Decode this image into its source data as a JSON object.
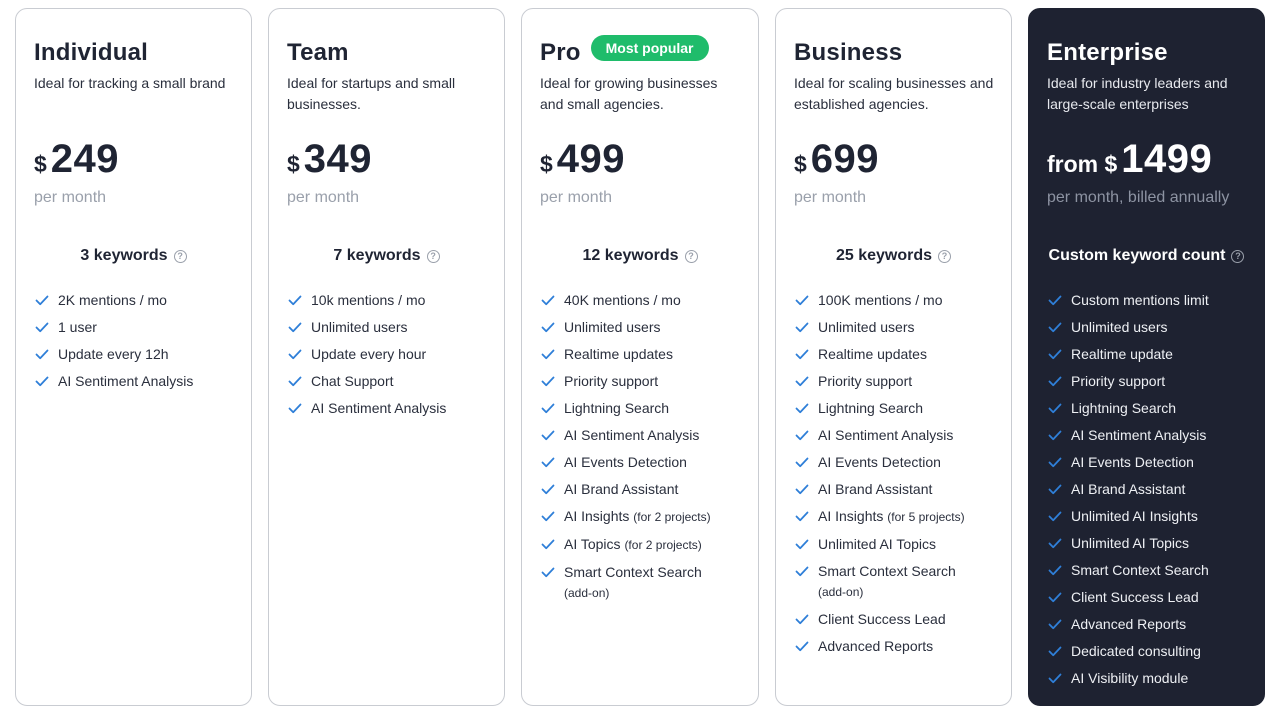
{
  "plans": [
    {
      "title": "Individual",
      "description": "Ideal for tracking a small brand",
      "price_prefix": "$",
      "price": "249",
      "period": "per month",
      "keywords": "3 keywords",
      "features": [
        {
          "text": "2K mentions / mo",
          "note": ""
        },
        {
          "text": "1 user",
          "note": ""
        },
        {
          "text": "Update every 12h",
          "note": ""
        },
        {
          "text": "AI Sentiment Analysis",
          "note": ""
        }
      ]
    },
    {
      "title": "Team",
      "description": "Ideal for startups and small businesses.",
      "price_prefix": "$",
      "price": "349",
      "period": "per month",
      "keywords": "7 keywords",
      "features": [
        {
          "text": "10k mentions / mo",
          "note": ""
        },
        {
          "text": "Unlimited users",
          "note": ""
        },
        {
          "text": "Update every hour",
          "note": ""
        },
        {
          "text": "Chat Support",
          "note": ""
        },
        {
          "text": "AI Sentiment Analysis",
          "note": ""
        }
      ]
    },
    {
      "title": "Pro",
      "badge": "Most popular",
      "description": "Ideal for growing businesses and small agencies.",
      "price_prefix": "$",
      "price": "499",
      "period": "per month",
      "keywords": "12 keywords",
      "features": [
        {
          "text": "40K mentions / mo",
          "note": ""
        },
        {
          "text": "Unlimited users",
          "note": ""
        },
        {
          "text": "Realtime updates",
          "note": ""
        },
        {
          "text": "Priority support",
          "note": ""
        },
        {
          "text": "Lightning Search",
          "note": ""
        },
        {
          "text": "AI Sentiment Analysis",
          "note": ""
        },
        {
          "text": "AI Events Detection",
          "note": ""
        },
        {
          "text": "AI Brand Assistant",
          "note": ""
        },
        {
          "text": "AI Insights",
          "note": "(for 2 projects)"
        },
        {
          "text": "AI Topics",
          "note": "(for 2 projects)"
        },
        {
          "text": "Smart Context Search",
          "subline": "(add-on)"
        }
      ]
    },
    {
      "title": "Business",
      "description": "Ideal for scaling businesses and established agencies.",
      "price_prefix": "$",
      "price": "699",
      "period": "per month",
      "keywords": "25 keywords",
      "features": [
        {
          "text": "100K mentions / mo",
          "note": ""
        },
        {
          "text": "Unlimited users",
          "note": ""
        },
        {
          "text": "Realtime updates",
          "note": ""
        },
        {
          "text": "Priority support",
          "note": ""
        },
        {
          "text": "Lightning Search",
          "note": ""
        },
        {
          "text": "AI Sentiment Analysis",
          "note": ""
        },
        {
          "text": "AI Events Detection",
          "note": ""
        },
        {
          "text": "AI Brand Assistant",
          "note": ""
        },
        {
          "text": "AI Insights",
          "note": "(for 5 projects)"
        },
        {
          "text": "Unlimited AI Topics",
          "note": ""
        },
        {
          "text": "Smart Context Search",
          "subline": "(add-on)"
        },
        {
          "text": "Client Success Lead",
          "note": ""
        },
        {
          "text": "Advanced Reports",
          "note": ""
        }
      ]
    },
    {
      "title": "Enterprise",
      "description": "Ideal for industry leaders and large-scale enterprises",
      "price_prefix": "from $",
      "price": "1499",
      "period": "per month, billed annually",
      "keywords": "Custom keyword count",
      "features": [
        {
          "text": "Custom mentions limit",
          "note": ""
        },
        {
          "text": "Unlimited users",
          "note": ""
        },
        {
          "text": "Realtime update",
          "note": ""
        },
        {
          "text": "Priority support",
          "note": ""
        },
        {
          "text": "Lightning Search",
          "note": ""
        },
        {
          "text": "AI Sentiment Analysis",
          "note": ""
        },
        {
          "text": "AI Events Detection",
          "note": ""
        },
        {
          "text": "AI Brand Assistant",
          "note": ""
        },
        {
          "text": "Unlimited AI Insights",
          "note": ""
        },
        {
          "text": "Unlimited AI Topics",
          "note": ""
        },
        {
          "text": "Smart Context Search",
          "note": ""
        },
        {
          "text": "Client Success Lead",
          "note": ""
        },
        {
          "text": "Advanced Reports",
          "note": ""
        },
        {
          "text": "Dedicated consulting",
          "note": ""
        },
        {
          "text": "AI Visibility module",
          "note": ""
        }
      ]
    }
  ],
  "colors": {
    "check": "#2f7fd8",
    "badge": "#1fbc6b",
    "dark_card": "#1e2231"
  },
  "icons": {
    "check": "check-icon",
    "help": "help-circle-icon"
  }
}
